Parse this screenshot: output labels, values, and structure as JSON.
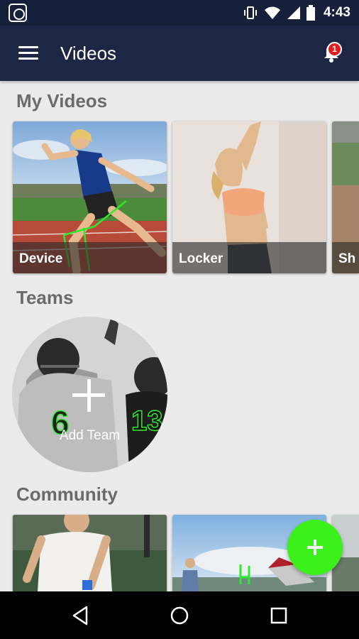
{
  "status_bar": {
    "time": "4:43"
  },
  "app_bar": {
    "title": "Videos",
    "notification_count": "1"
  },
  "my_videos": {
    "title": "My Videos",
    "cards": [
      {
        "label": "Device"
      },
      {
        "label": "Locker"
      },
      {
        "label": "Sh"
      }
    ]
  },
  "teams": {
    "title": "Teams",
    "add_label": "Add Team"
  },
  "community": {
    "title": "Community"
  },
  "colors": {
    "app_bar": "#1d2645",
    "fab": "#3bf01b",
    "badge": "#e21f1f"
  },
  "icons": {
    "menu": "hamburger-icon",
    "bell": "bell-icon",
    "fab": "plus-icon",
    "nav": [
      "back-icon",
      "home-icon",
      "recents-icon"
    ]
  }
}
